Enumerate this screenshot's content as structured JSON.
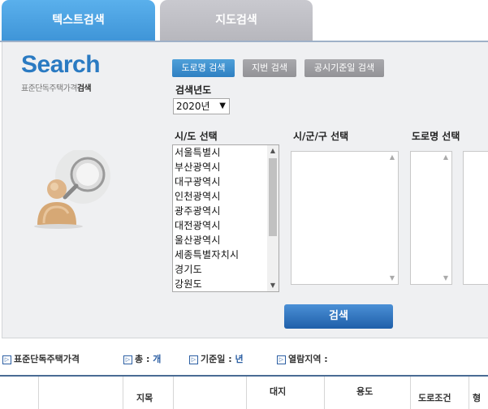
{
  "tabs": [
    {
      "label": "텍스트검색",
      "active": true
    },
    {
      "label": "지도검색",
      "active": false
    }
  ],
  "logo": {
    "title": "Search",
    "subtitle_prefix": "표준단독주택가격",
    "subtitle_bold": "검색"
  },
  "search_modes": [
    {
      "label": "도로명 검색",
      "active": true
    },
    {
      "label": "지번 검색",
      "active": false
    },
    {
      "label": "공시기준일 검색",
      "active": false
    }
  ],
  "year": {
    "label": "검색년도",
    "value": "2020년"
  },
  "sido": {
    "label": "시/도 선택",
    "items": [
      "서울특별시",
      "부산광역시",
      "대구광역시",
      "인천광역시",
      "광주광역시",
      "대전광역시",
      "울산광역시",
      "세종특별자치시",
      "경기도",
      "강원도"
    ]
  },
  "sigungu": {
    "label": "시/군/구 선택"
  },
  "road": {
    "label": "도로명 선택"
  },
  "search_button": "검색",
  "info": {
    "title": "표준단독주택가격",
    "total_label": "총 :",
    "total_value": "개",
    "date_label": "기준일 :",
    "date_value": "년",
    "area_label": "열람지역 :",
    "area_value": ""
  },
  "table_headers": {
    "col3": "지목",
    "col5": "대지",
    "col6": "용도",
    "col7": "도로조건",
    "col8": "형"
  },
  "colors": {
    "accent": "#3f95d8",
    "logo": "#2a7ac2",
    "button": "#1f5fa9",
    "panel_bg": "#eff0f2"
  }
}
